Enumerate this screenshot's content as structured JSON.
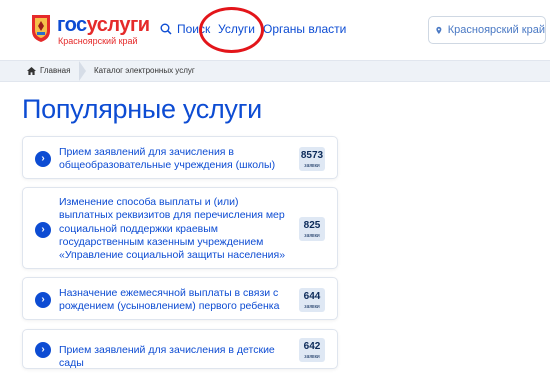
{
  "header": {
    "brand_part1": "гос",
    "brand_part2": "услуги",
    "region_name": "Красноярский край",
    "nav": {
      "search": "Поиск",
      "services": "Услуги",
      "government": "Органы власти"
    },
    "location": "Красноярский край"
  },
  "breadcrumb": {
    "home": "Главная",
    "current": "Каталог электронных услуг"
  },
  "page": {
    "title": "Популярные услуги"
  },
  "services": [
    {
      "label": "Прием заявлений для зачисления в общеобразовательные учреждения (школы)",
      "count": "8573",
      "unit": "заявки"
    },
    {
      "label": "Изменение способа выплаты и (или) выплатных реквизитов для перечисления мер социальной поддержки краевым государственным казенным учреждением «Управление социальной защиты населения»",
      "count": "825",
      "unit": "заявки"
    },
    {
      "label": "Назначение ежемесячной выплаты в связи с рождением (усыновлением) первого ребенка",
      "count": "644",
      "unit": "заявки"
    },
    {
      "label": "Прием заявлений для зачисления в детские сады",
      "count": "642",
      "unit": "заявки"
    }
  ],
  "colors": {
    "accent": "#0d4cd3",
    "brand_red": "#e52a2a",
    "annotation_circle": "#e3151a"
  }
}
